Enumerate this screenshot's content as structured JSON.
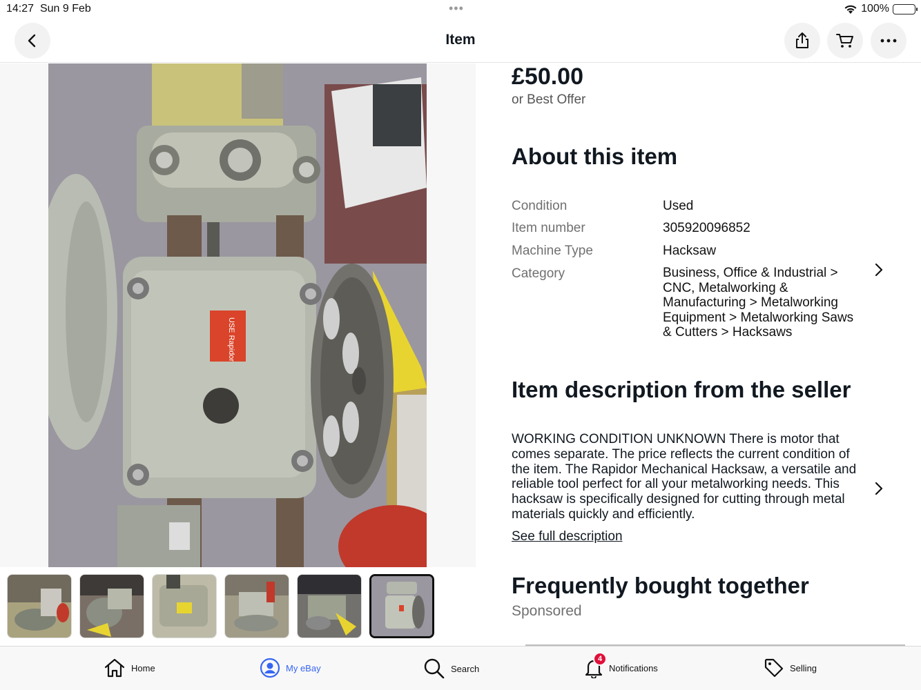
{
  "status_bar": {
    "time": "14:27",
    "date": "Sun 9 Feb",
    "dots": "•••",
    "battery": "100%"
  },
  "nav": {
    "title": "Item",
    "back_icon": "chevron-left-icon",
    "share_icon": "share-icon",
    "cart_icon": "cart-icon",
    "more_icon": "more-icon"
  },
  "gallery": {
    "main_alt": "Rapidor mechanical hacksaw gearbox photo",
    "label_text": "USE Rapidor",
    "thumbnails": 6,
    "selected_index": 6
  },
  "listing": {
    "price": "£50.00",
    "offer": "or Best Offer"
  },
  "about": {
    "heading": "About this item",
    "specs": [
      {
        "label": "Condition",
        "value": "Used"
      },
      {
        "label": "Item number",
        "value": "305920096852"
      },
      {
        "label": "Machine Type",
        "value": "Hacksaw"
      },
      {
        "label": "Category",
        "lines": [
          "Business, Office & Industrial >",
          "CNC, Metalworking &",
          "Manufacturing > Metalworking",
          "Equipment > Metalworking Saws",
          "& Cutters > Hacksaws"
        ]
      }
    ]
  },
  "description": {
    "heading": "Item description from the seller",
    "lines": [
      "WORKING CONDITION UNKNOWN There is motor that",
      "comes separate. The price reflects the current condition of",
      "the item. The Rapidor Mechanical Hacksaw, a versatile and",
      "reliable tool perfect for all your metalworking needs. This",
      "hacksaw is specifically designed for cutting through metal",
      "materials quickly and efficiently."
    ],
    "see_full": "See full description"
  },
  "related": {
    "heading": "Frequently bought together",
    "sponsored": "Sponsored"
  },
  "tab_bar": {
    "tabs": [
      {
        "label": "Home",
        "icon": "home-icon"
      },
      {
        "label": "My eBay",
        "icon": "user-icon",
        "active": true
      },
      {
        "label": "Search",
        "icon": "search-icon"
      },
      {
        "label": "Notifications",
        "icon": "bell-icon",
        "badge": "4"
      },
      {
        "label": "Selling",
        "icon": "tag-icon"
      }
    ]
  },
  "colors": {
    "accent": "#3665f3",
    "badge": "#e0103a",
    "text": "#111820",
    "muted": "#707070"
  }
}
